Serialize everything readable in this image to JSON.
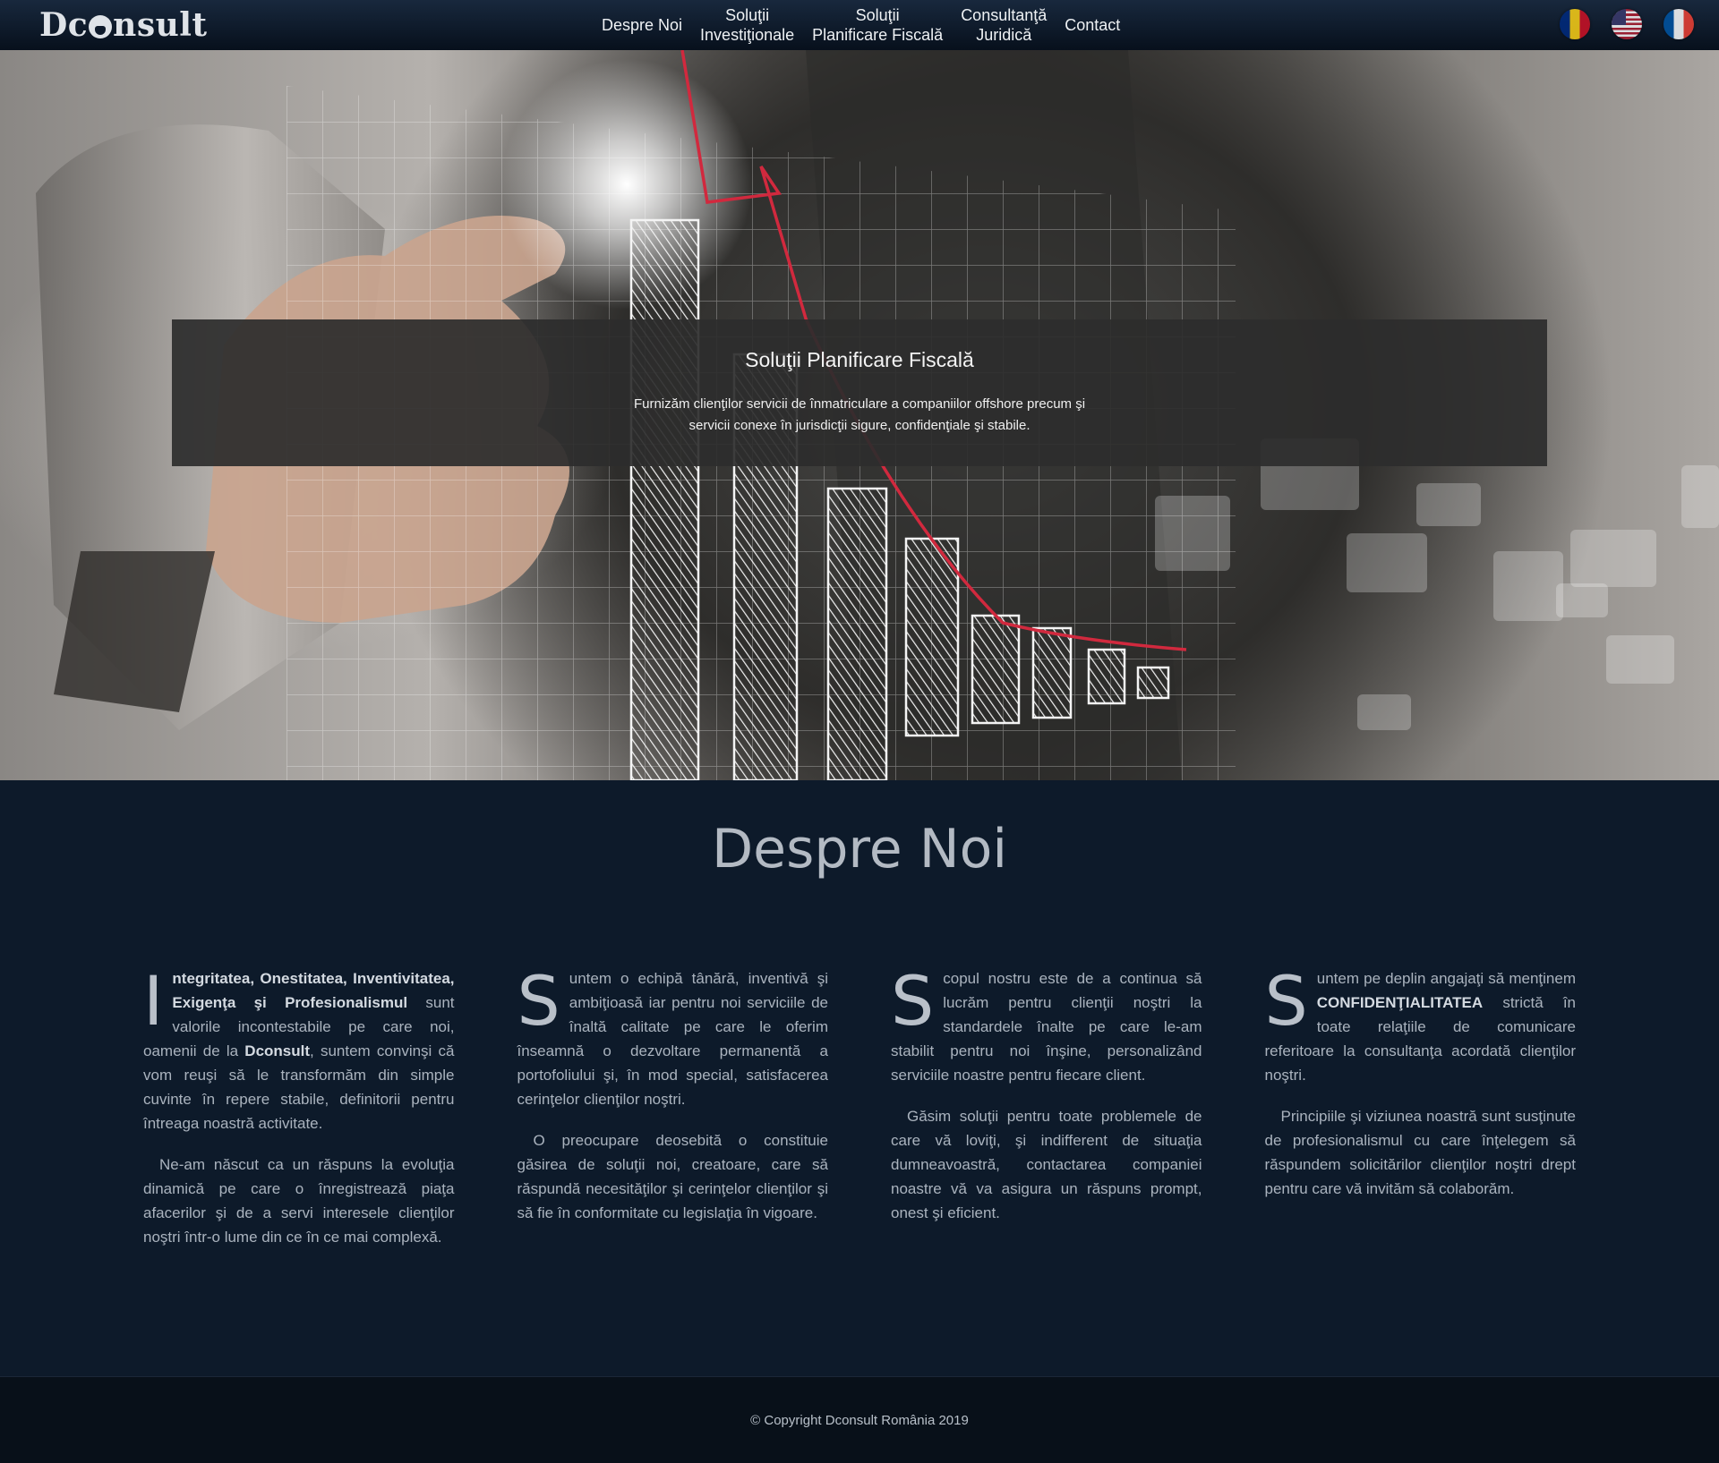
{
  "brand": {
    "logo_text_1": "Dc",
    "logo_text_2": "nsult"
  },
  "nav": {
    "items": [
      {
        "line1": "Despre Noi",
        "line2": ""
      },
      {
        "line1": "Soluţii",
        "line2": "Investiţionale"
      },
      {
        "line1": "Soluţii",
        "line2": "Planificare Fiscală"
      },
      {
        "line1": "Consultanţă",
        "line2": "Juridică"
      },
      {
        "line1": "Contact",
        "line2": ""
      }
    ],
    "flags": [
      "romania-flag-icon",
      "usa-flag-icon",
      "france-flag-icon"
    ]
  },
  "hero": {
    "title": "Soluţii Planificare Fiscală",
    "text": "Furnizăm clienţilor servicii de înmatriculare a companiilor offshore precum şi servicii conexe în jurisdicţii sigure, confidenţiale şi stabile."
  },
  "about": {
    "title": "Despre Noi",
    "col1": {
      "dropcap": "I",
      "bold1": "ntegritatea, Onestitatea, Inventivitatea, Exigenţa şi Profesionalismul",
      "rest1": " sunt valorile incontestabile pe care noi, oamenii de la ",
      "bold2": "Dconsult",
      "rest2": ", suntem convinşi că vom reuşi să le transformăm din simple cuvinte în repere stabile, definitorii pentru întreaga noastră activitate.",
      "p2": "Ne-am născut ca un răspuns la evoluţia dinamică pe care o înregistrează piaţa afacerilor şi de a servi interesele clienţilor noştri într-o lume din ce în ce mai complexă."
    },
    "col2": {
      "dropcap": "S",
      "p1": "untem o echipă tânără, inventivă şi ambiţioasă iar pentru noi serviciile de înaltă calitate pe care le oferim înseamnă o dezvoltare permanentă a portofoliului şi, în mod special, satisfacerea cerinţelor clienţilor noştri.",
      "p2": "O preocupare deosebită o constituie găsirea de soluţii noi, creatoare, care să răspundă necesităţilor şi cerinţelor clienţilor şi să fie în conformitate cu legislaţia în vigoare."
    },
    "col3": {
      "dropcap": "S",
      "p1": "copul nostru este de a continua să lucrăm pentru clienţii noştri la standardele înalte pe care le-am stabilit pentru noi înşine, personalizând serviciile noastre pentru fiecare client.",
      "p2": "Găsim soluţii pentru toate problemele de care vă loviţi, şi indifferent de situaţia dumneavoastră, contactarea companiei noastre vă va asigura un răspuns prompt, onest şi eficient."
    },
    "col4": {
      "dropcap": "S",
      "pre": "untem pe deplin angajaţi să menţinem ",
      "bold": "CONFIDENŢIALITATEA",
      "post": " strictă în toate relaţiile de comunicare referitoare la consultanţa acordată clienţilor noştri.",
      "p2": "Principiile şi viziunea noastră sunt susţinute de profesionalismul cu care înţelegem să răspundem solicitărilor clienţilor noştri drept pentru care vă invităm să colaborăm."
    }
  },
  "footer": {
    "copyright": "© Copyright Dconsult România 2019"
  }
}
